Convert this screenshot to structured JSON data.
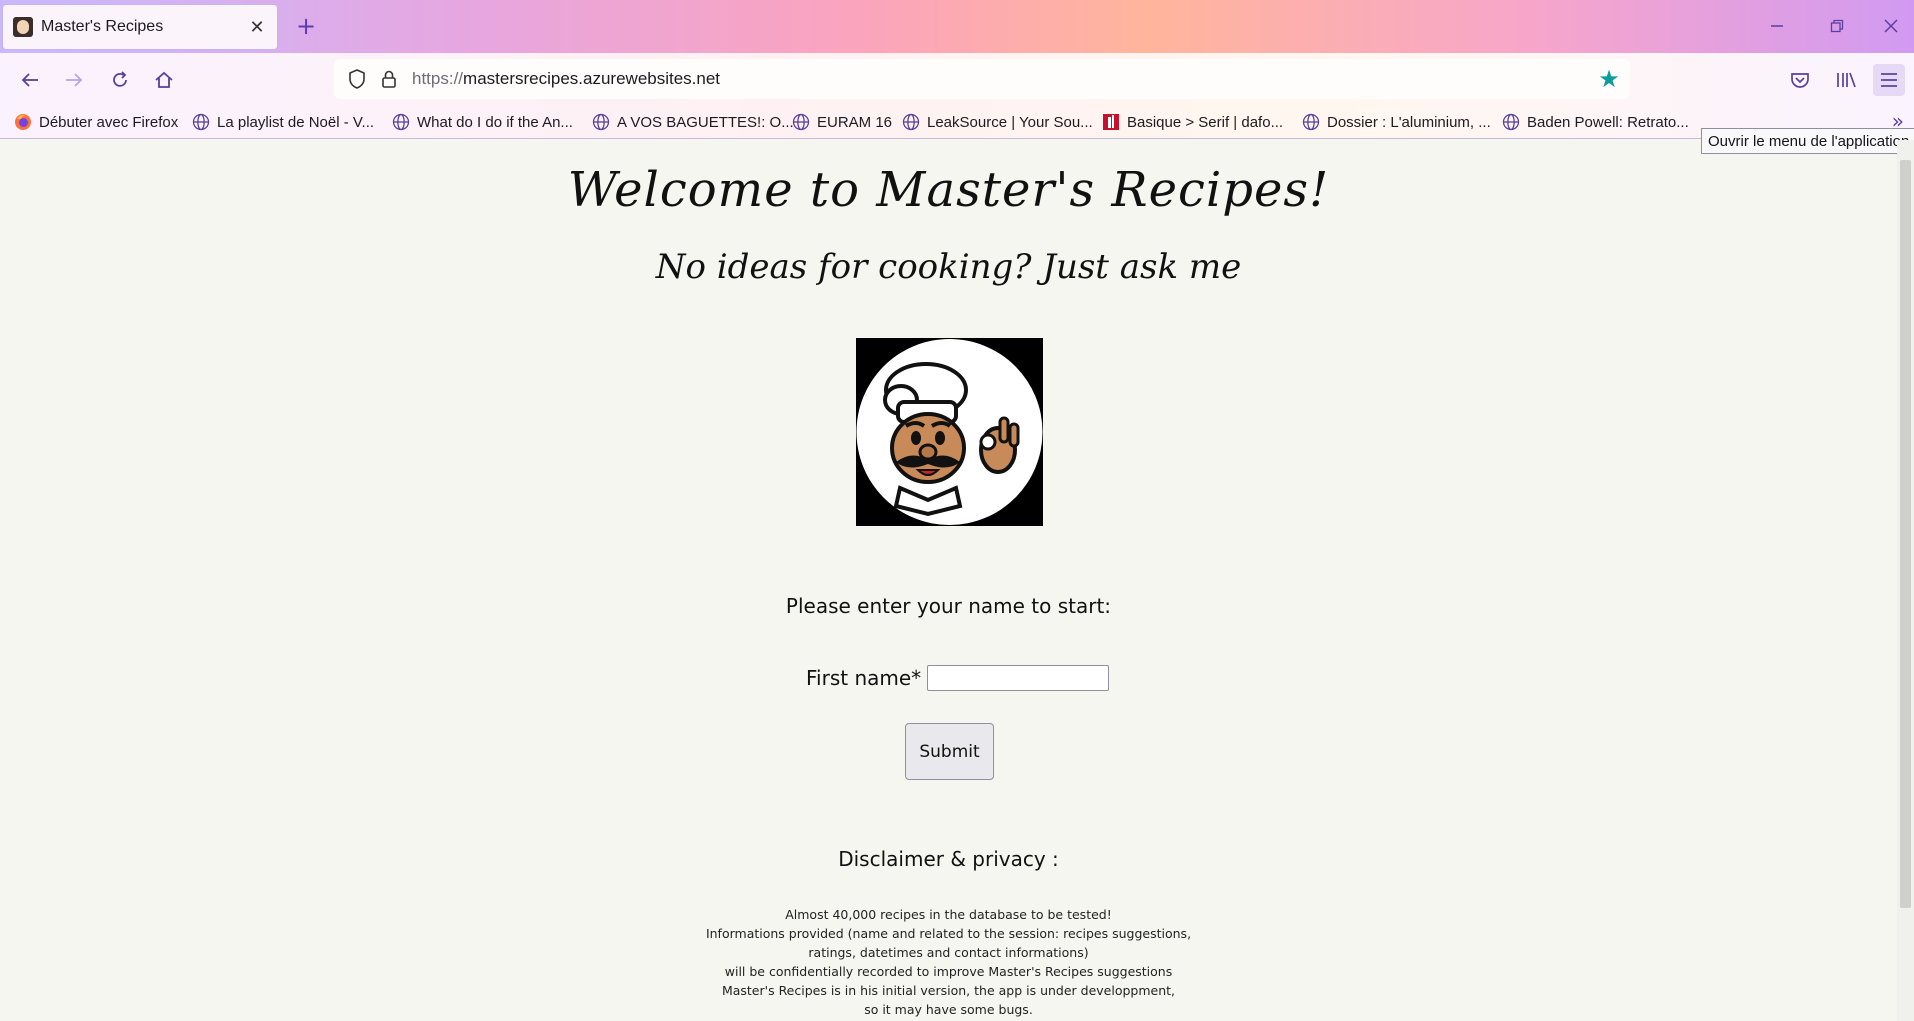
{
  "browser": {
    "tab": {
      "title": "Master's Recipes",
      "close": "✕"
    },
    "new_tab": "+",
    "url": {
      "protocol": "https://",
      "host": "mastersrecipes.azurewebsites.net"
    },
    "bookmarks": [
      {
        "label": "Débuter avec Firefox",
        "icon": "firefox-icon"
      },
      {
        "label": "La playlist de Noël - V...",
        "icon": "globe-icon"
      },
      {
        "label": "What do I do if the An...",
        "icon": "globe-icon"
      },
      {
        "label": "A VOS BAGUETTES!: O...",
        "icon": "globe-icon"
      },
      {
        "label": "EURAM 16",
        "icon": "globe-icon"
      },
      {
        "label": "LeakSource | Your Sou...",
        "icon": "globe-icon"
      },
      {
        "label": "Basique > Serif | dafo...",
        "icon": "dafont-icon"
      },
      {
        "label": "Dossier : L'aluminium, ...",
        "icon": "globe-icon"
      },
      {
        "label": "Baden Powell: Retrato...",
        "icon": "globe-icon"
      }
    ],
    "tooltip": "Ouvrir le menu de l'application"
  },
  "page": {
    "welcome": "Welcome to Master's Recipes!",
    "subtitle": "No ideas for cooking? Just ask me",
    "prompt": "Please enter your name to start:",
    "first_name_label": "First name*",
    "first_name_value": "",
    "submit_label": "Submit",
    "disclaimer_title": "Disclaimer & privacy :",
    "disclaimer_lines": [
      "Almost 40,000 recipes in the database to be tested!",
      "Informations provided (name and related to the session: recipes suggestions,",
      "ratings, datetimes and contact informations)",
      "will be confidentially recorded to improve Master's Recipes suggestions",
      "Master's Recipes is in his initial version, the app is under developpment,",
      "so it may have some bugs."
    ]
  },
  "colors": {
    "accent": "#5a3f9c",
    "star": "#0b9c9c",
    "page_bg": "#f6f6f1"
  }
}
